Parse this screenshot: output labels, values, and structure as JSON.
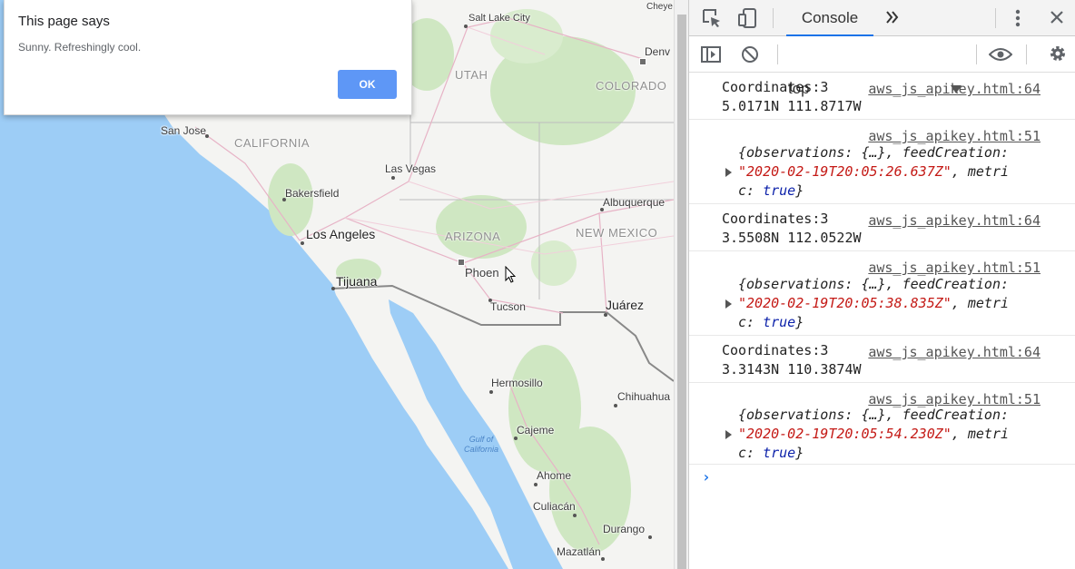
{
  "alert": {
    "title": "This page says",
    "message": "Sunny. Refreshingly cool.",
    "ok_label": "OK"
  },
  "map": {
    "cities": {
      "salt_lake_city": "Salt Lake City",
      "cheyenne": "Cheye",
      "denver": "Denv",
      "san_jose": "San Jose",
      "las_vegas": "Las Vegas",
      "bakersfield": "Bakersfield",
      "albuquerque": "Albuquerque",
      "los_angeles": "Los Angeles",
      "tijuana": "Tijuana",
      "phoenix": "Phoen",
      "tucson": "Tucson",
      "juarez": "Juárez",
      "hermosillo": "Hermosillo",
      "chihuahua": "Chihuahua",
      "cajeme": "Cajeme",
      "ahome": "Ahome",
      "culiacan": "Culiacán",
      "durango": "Durango",
      "mazatlan": "Mazatlán"
    },
    "states": {
      "utah": "UTAH",
      "colorado": "COLORADO",
      "california": "CALIFORNIA",
      "arizona": "ARIZONA",
      "new_mexico": "NEW MEXICO"
    },
    "sea": {
      "line1": "Gulf of",
      "line2": "California"
    },
    "colors": {
      "water": "#9dcdf6",
      "land": "#f4f4f2",
      "forest": "#cfe7c2",
      "border": "#777777"
    }
  },
  "devtools": {
    "tabs": {
      "console": "Console"
    },
    "context_selector": "top",
    "colors": {
      "accent": "#1a73e8",
      "string": "#c41a16",
      "keyword": "#0d22aa"
    },
    "logs": [
      {
        "type": "coords",
        "line1": "Coordinates:3",
        "line2": "5.0171N 111.8717W",
        "source": "aws_js_apikey.html:64"
      },
      {
        "type": "object",
        "source": "aws_js_apikey.html:51",
        "line1": "{observations: {…}, feedCreation:",
        "str": "\"2020-02-19T20:05:26.637Z\"",
        "after": ", metri",
        "line3a": "c: ",
        "line3b": "true",
        "line3c": "}"
      },
      {
        "type": "coords",
        "line1": "Coordinates:3",
        "line2": "3.5508N 112.0522W",
        "source": "aws_js_apikey.html:64"
      },
      {
        "type": "object",
        "source": "aws_js_apikey.html:51",
        "line1": "{observations: {…}, feedCreation:",
        "str": "\"2020-02-19T20:05:38.835Z\"",
        "after": ", metri",
        "line3a": "c: ",
        "line3b": "true",
        "line3c": "}"
      },
      {
        "type": "coords",
        "line1": "Coordinates:3",
        "line2": "3.3143N 110.3874W",
        "source": "aws_js_apikey.html:64"
      },
      {
        "type": "object",
        "source": "aws_js_apikey.html:51",
        "line1": "{observations: {…}, feedCreation:",
        "str": "\"2020-02-19T20:05:54.230Z\"",
        "after": ", metri",
        "line3a": "c: ",
        "line3b": "true",
        "line3c": "}"
      }
    ],
    "prompt": "›"
  }
}
